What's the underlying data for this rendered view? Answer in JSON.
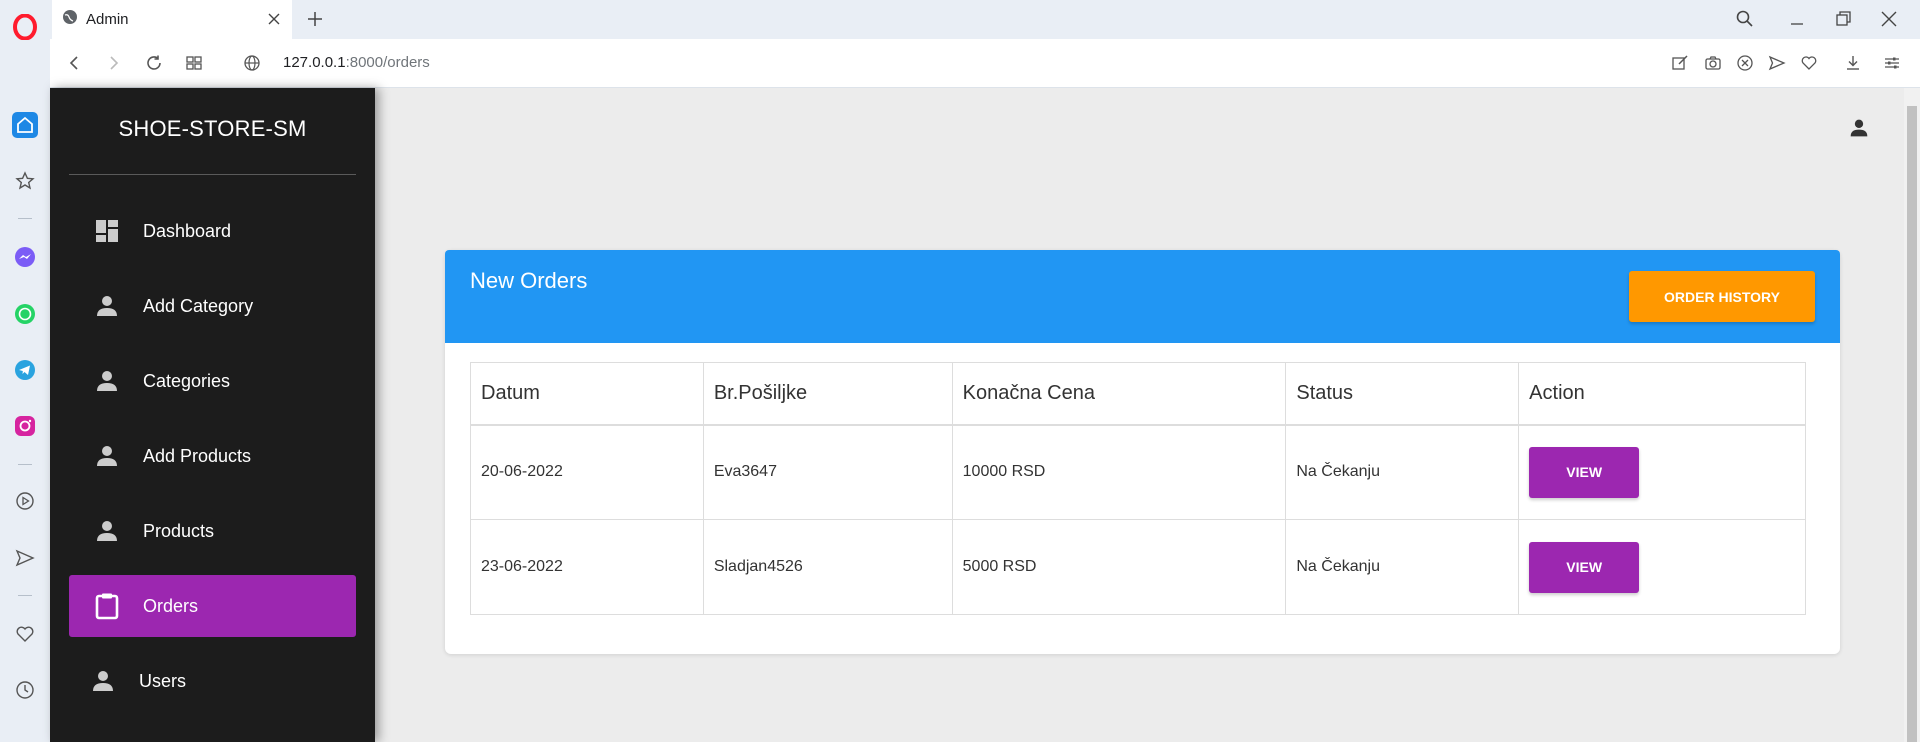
{
  "browser": {
    "tab_title": "Admin",
    "url_host": "127.0.0.1",
    "url_path": ":8000/orders"
  },
  "app": {
    "brand": "SHOE-STORE-SM",
    "nav": [
      {
        "label": "Dashboard",
        "icon": "dashboard-icon",
        "active": false
      },
      {
        "label": "Add Category",
        "icon": "person-icon",
        "active": false
      },
      {
        "label": "Categories",
        "icon": "person-icon",
        "active": false
      },
      {
        "label": "Add Products",
        "icon": "person-icon",
        "active": false
      },
      {
        "label": "Products",
        "icon": "person-icon",
        "active": false
      },
      {
        "label": "Orders",
        "icon": "clipboard-icon",
        "active": true
      },
      {
        "label": "Users",
        "icon": "person-icon",
        "active": false
      }
    ]
  },
  "orders": {
    "title": "New Orders",
    "history_button": "ORDER HISTORY",
    "columns": [
      "Datum",
      "Br.Pošiljke",
      "Konačna Cena",
      "Status",
      "Action"
    ],
    "rows": [
      {
        "datum": "20-06-2022",
        "posiljka": "Eva3647",
        "cena": "10000 RSD",
        "status": "Na Čekanju",
        "action": "VIEW"
      },
      {
        "datum": "23-06-2022",
        "posiljka": "Sladjan4526",
        "cena": "5000 RSD",
        "status": "Na Čekanju",
        "action": "VIEW"
      }
    ]
  },
  "colors": {
    "sidebar": "#1c1c1c",
    "active_nav": "#9c27b0",
    "header_blue": "#2196f3",
    "history_orange": "#ff9800",
    "view_purple": "#9c27b0"
  }
}
